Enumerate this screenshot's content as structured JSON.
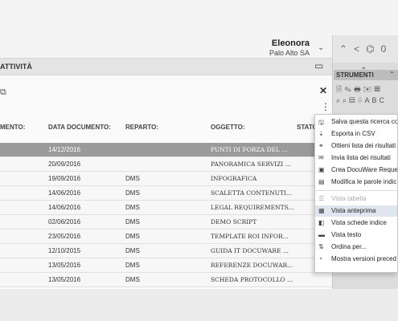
{
  "header": {
    "user_name": "Eleonora",
    "user_org": "Palo Alto SA",
    "chevron": "⌄",
    "nav_icons": [
      "⌃",
      "<",
      "⌬",
      "0"
    ]
  },
  "tab": {
    "label": "ATTIVITÀ"
  },
  "table": {
    "columns": [
      "MENTO:",
      "DATA DOCUMENTO:",
      "REPARTO:",
      "OGGETTO:",
      "STATO"
    ],
    "rows": [
      {
        "date": "14/12/2016",
        "dept": "",
        "subject": "PUNTI DI FORZA DEL ...",
        "selected": true
      },
      {
        "date": "20/09/2016",
        "dept": "",
        "subject": "PANORAMICA SERVIZI ..."
      },
      {
        "date": "19/09/2016",
        "dept": "DMS",
        "subject": "INFOGRAFICA"
      },
      {
        "date": "14/06/2016",
        "dept": "DMS",
        "subject": "SCALETTA CONTENUTI..."
      },
      {
        "date": "14/06/2016",
        "dept": "DMS",
        "subject": "LEGAL REQUIREMENTS..."
      },
      {
        "date": "02/06/2016",
        "dept": "DMS",
        "subject": "DEMO SCRIPT"
      },
      {
        "date": "23/05/2016",
        "dept": "DMS",
        "subject": "TEMPLATE ROI INFOR..."
      },
      {
        "date": "12/10/2015",
        "dept": "DMS",
        "subject": "GUIDA IT DOCUWARE ..."
      },
      {
        "date": "13/05/2016",
        "dept": "DMS",
        "subject": "REFERENZE DOCUWAR..."
      },
      {
        "date": "13/05/2016",
        "dept": "DMS",
        "subject": "SCHEDA PROTOCOLLO ..."
      }
    ]
  },
  "tools": {
    "title": "STRUMENTI",
    "icons": "🗎✎🖶✉▦ ⌕⌕▤⇩ABC"
  },
  "menu": {
    "items": [
      {
        "icon": "🖫",
        "label": "Salva questa ricerca co",
        "disabled": false,
        "active": false
      },
      {
        "icon": "⇣",
        "label": "Esporta in CSV",
        "disabled": false,
        "active": false
      },
      {
        "icon": "⚭",
        "label": "Ottieni lista dei risultati",
        "disabled": false,
        "active": false
      },
      {
        "icon": "✉",
        "label": "Invia lista dei risultati",
        "disabled": false,
        "active": false
      },
      {
        "icon": "▣",
        "label": "Crea DocuWare Reque",
        "disabled": false,
        "active": false
      },
      {
        "icon": "▤",
        "label": "Modifica le parole indic",
        "disabled": false,
        "active": false
      },
      {
        "icon": "☰",
        "label": "Vista tabella",
        "disabled": true,
        "active": false
      },
      {
        "icon": "▦",
        "label": "Vista anteprima",
        "disabled": false,
        "active": true
      },
      {
        "icon": "◧",
        "label": "Vista schede indice",
        "disabled": false,
        "active": false
      },
      {
        "icon": "▬",
        "label": "Vista testo",
        "disabled": false,
        "active": false
      },
      {
        "icon": "⇅",
        "label": "Ordina per...",
        "disabled": false,
        "active": false
      },
      {
        "icon": "◔",
        "label": "Mostra versioni preced",
        "disabled": false,
        "active": false
      }
    ]
  }
}
